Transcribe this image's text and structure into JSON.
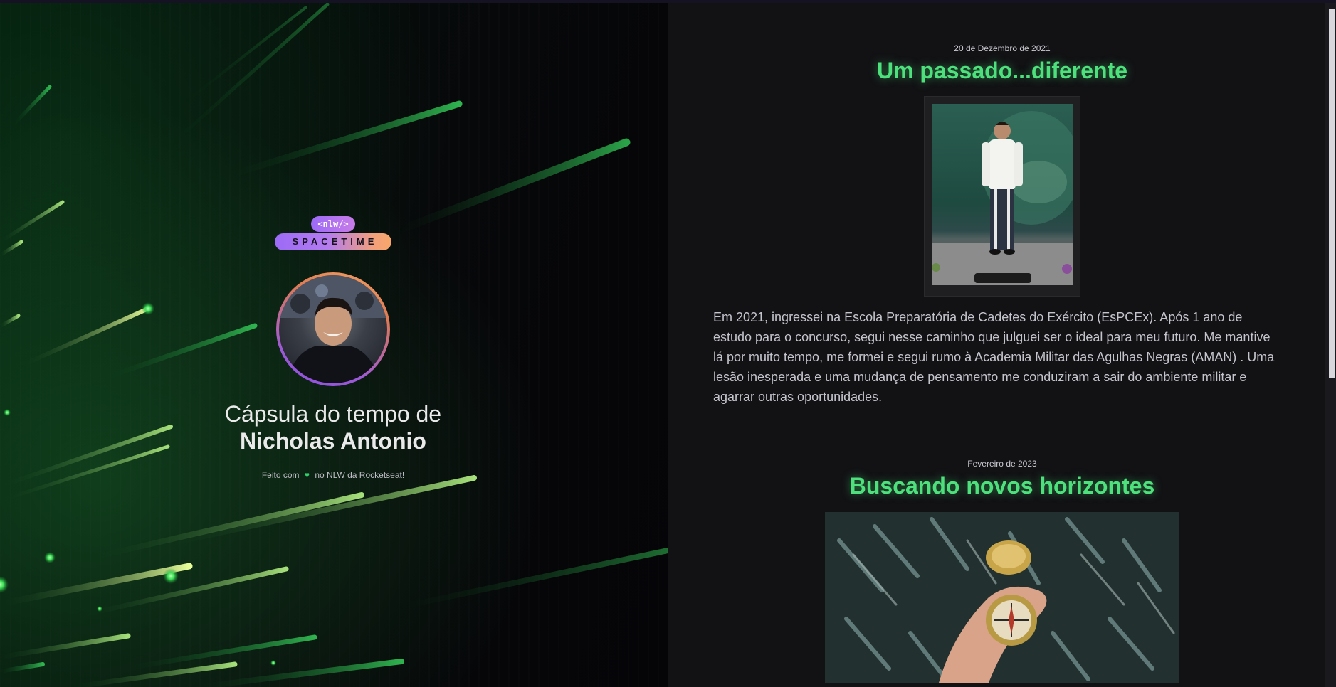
{
  "app": {
    "logo_tag": "<nlw/>",
    "logo_word": "SPACETIME"
  },
  "hero": {
    "title_prefix": "Cápsula do tempo de",
    "name": "Nicholas Antonio",
    "credit_before": "Feito com",
    "credit_heart": "♥",
    "credit_after": "no NLW da Rocketseat!"
  },
  "memories": [
    {
      "date": "20 de Dezembro de 2021",
      "title": "Um passado...diferente",
      "text": "Em 2021, ingressei na Escola Preparatória de Cadetes do Exército (EsPCEx). Após 1 ano de estudo para o concurso, segui nesse caminho que julguei ser o ideal para meu futuro. Me mantive lá por muito tempo, me formei e segui rumo à Academia Militar das Agulhas Negras (AMAN) . Uma lesão inesperada e uma mudança de pensamento me conduziram a sair do ambiente militar e agarrar outras oportunidades."
    },
    {
      "date": "Fevereiro de 2023",
      "title": "Buscando novos horizontes"
    }
  ],
  "colors": {
    "accent_green": "#4ee07c",
    "heart_green": "#30d36a",
    "background": "#121215"
  }
}
